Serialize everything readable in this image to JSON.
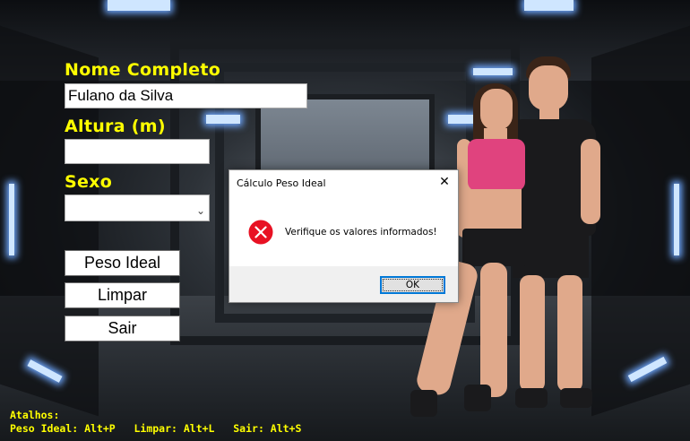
{
  "form": {
    "nome_label": "Nome Completo",
    "nome_value": "Fulano da Silva",
    "altura_label": "Altura (m)",
    "altura_value": "",
    "sexo_label": "Sexo",
    "sexo_value": "",
    "peso_button": "Peso Ideal",
    "limpar_button": "Limpar",
    "sair_button": "Sair"
  },
  "shortcuts": {
    "title": "Atalhos:",
    "line": "Peso Ideal: Alt+P   Limpar: Alt+L   Sair: Alt+S"
  },
  "dialog": {
    "title": "Cálculo Peso Ideal",
    "close": "✕",
    "message": "Verifique os valores informados!",
    "ok_label": "OK",
    "icon": "error-icon"
  },
  "colors": {
    "label_yellow": "#ffff00",
    "error_red": "#e81123",
    "focus_blue": "#0078d7"
  }
}
